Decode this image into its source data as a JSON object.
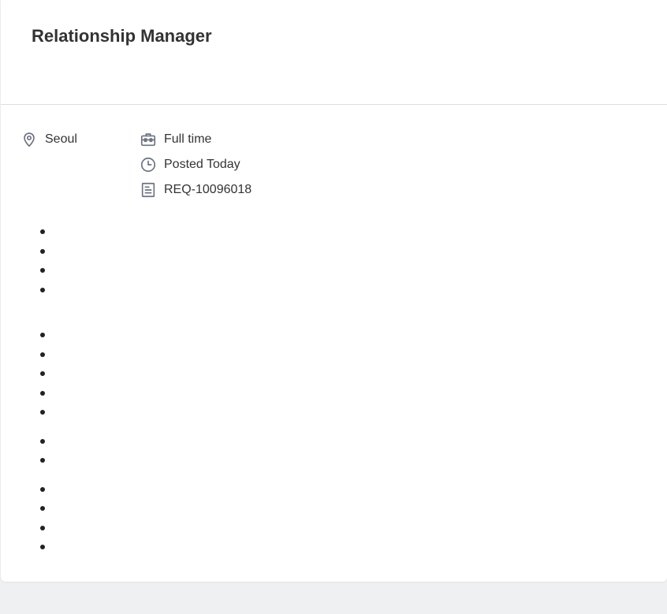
{
  "job": {
    "title": "Relationship Manager",
    "location": "Seoul",
    "employment_type": "Full time",
    "posted": "Posted Today",
    "requisition_id": "REQ-10096018"
  },
  "icons": {
    "location": "location-pin-icon",
    "employment_type": "briefcase-icon",
    "posted": "clock-icon",
    "requisition_id": "document-icon"
  },
  "colors": {
    "icon": "#6b7280",
    "divider": "#dcdfe3",
    "page_background": "#eff0f2"
  }
}
